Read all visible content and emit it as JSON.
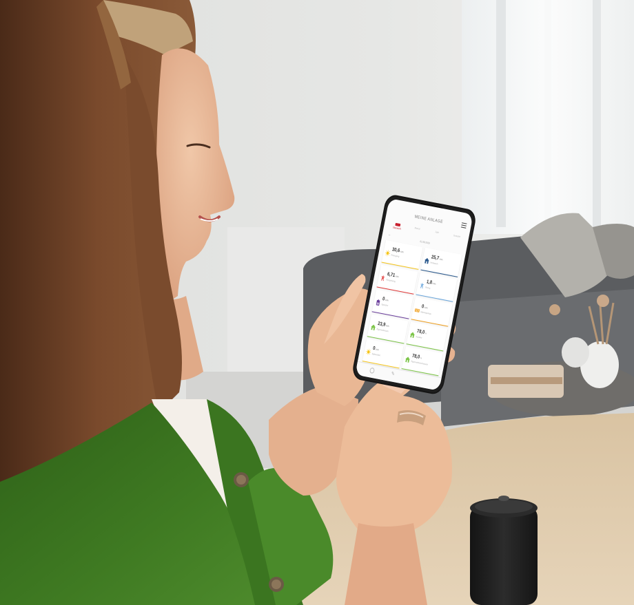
{
  "photo": {
    "description": "",
    "colors": {
      "wall": "#e4e4e2",
      "shirt": "#3f7a22",
      "hair": "#6a4026",
      "skin": "#e8b897",
      "sofa": "#5b5d60",
      "table": "#d8c09e"
    }
  },
  "app": {
    "title": "MEINE ANLAGE",
    "menu_icon": "hamburger-menu-icon",
    "back_icon": "arrow-left-icon",
    "date": "01.08.2019",
    "tabs": [
      {
        "label": "Übersicht",
        "active": true
      },
      {
        "label": "Monat",
        "active": false
      },
      {
        "label": "Jahr",
        "active": false
      },
      {
        "label": "Gesamt",
        "active": false
      }
    ],
    "tiles": [
      {
        "value": "30,6",
        "unit": "kWh",
        "label": "Erzeugung",
        "icon": "sun-icon",
        "color": "#f6c61d"
      },
      {
        "value": "25,7",
        "unit": "kWh",
        "label": "Verbrauch",
        "icon": "house-icon",
        "color": "#2d5b8e"
      },
      {
        "value": "6,71",
        "unit": "kWh",
        "label": "Einspeisung",
        "icon": "power-tower-icon",
        "color": "#e23a3a"
      },
      {
        "value": "1,8",
        "unit": "kWh",
        "label": "Bezug",
        "icon": "power-tower-icon",
        "color": "#6aa6dc"
      },
      {
        "value": "0",
        "unit": "kWh",
        "label": "Speicher",
        "icon": "battery-icon",
        "color": "#6b3f9c"
      },
      {
        "value": "0",
        "unit": "kWh",
        "label": "Wärmepumpe",
        "icon": "heater-icon",
        "color": "#f0a020"
      },
      {
        "value": "23,9",
        "unit": "kWh",
        "label": "Eigenverbrauch",
        "icon": "house-icon",
        "color": "#7ec54a"
      },
      {
        "value": "78,0",
        "unit": "%",
        "label": "Autarkie",
        "icon": "house-icon",
        "color": "#7ec54a"
      },
      {
        "value": "0",
        "unit": "kWh",
        "label": "Spitzenlast",
        "icon": "sun-icon",
        "color": "#f6c61d"
      },
      {
        "value": "78,0",
        "unit": "%",
        "label": "Eigenverbrauchsquote",
        "icon": "house-icon",
        "color": "#7ec54a"
      }
    ],
    "bottom_icons": [
      "home-icon",
      "edit-pencil-icon"
    ]
  }
}
